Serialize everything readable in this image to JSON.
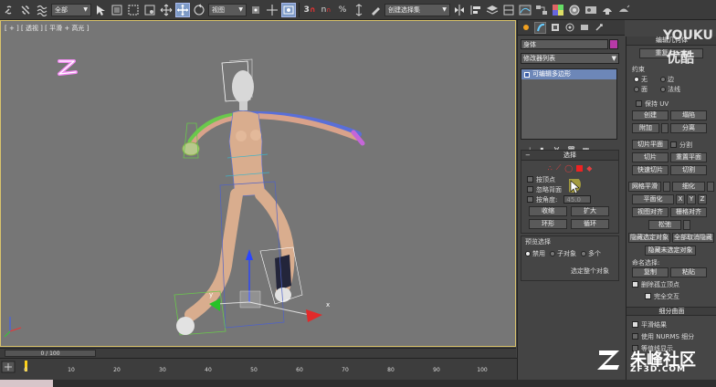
{
  "toolbar": {
    "selection_filter": "全部",
    "ref_coord": "视图",
    "named_selection": "创建选择集",
    "snap_label": "3",
    "angle_snap": "n",
    "percent_snap": "%"
  },
  "viewport": {
    "label": "[ + ] [ 透视 ] [ 平滑 + 高光 ]",
    "gizmo_labels": [
      "y",
      "x"
    ]
  },
  "command_panel": {
    "object_name": "身体",
    "modifier_list": "修改器列表",
    "stack_item": "可编辑多边形",
    "selection": {
      "header": "选择",
      "by_vertex": "按顶点",
      "ignore_backfacing": "忽略背面",
      "by_angle": "按角度:",
      "angle_value": "45.0",
      "shrink": "收缩",
      "grow": "扩大",
      "ring": "环形",
      "loop": "循环"
    },
    "preview": {
      "header": "预览选择",
      "off": "禁用",
      "subobject": "子对象",
      "multi": "多个",
      "whole_object": "选定整个对象"
    }
  },
  "right_panel": {
    "header": "编辑几何体",
    "repeat_last": "重复上一个",
    "constraints": "约束",
    "c_none": "无",
    "c_edge": "边",
    "c_face": "面",
    "c_normal": "法线",
    "preserve_uv": "保持 UV",
    "create": "创建",
    "collapse": "塌陷",
    "attach": "附加",
    "detach": "分离",
    "slice_plane": "切片平面",
    "split": "分割",
    "slice": "切片",
    "reset_plane": "重置平面",
    "quickslice": "快速切片",
    "cut": "切割",
    "meshsmooth": "网格平滑",
    "tessellate": "细化",
    "make_planar": "平面化",
    "x": "X",
    "y": "Y",
    "z": "Z",
    "view_align": "视图对齐",
    "grid_align": "栅格对齐",
    "relax": "松弛",
    "hide_selected": "隐藏选定对象",
    "unhide_all": "全部取消隐藏",
    "hide_unselected": "隐藏未选定对象",
    "named_sel": "命名选择:",
    "copy": "复制",
    "paste": "粘贴",
    "delete_iso": "删除孤立顶点",
    "full_interactivity": "完全交互",
    "subdiv_header": "细分曲面",
    "smooth_result": "平滑结果",
    "use_nurms": "使用 NURMS 细分",
    "isoline": "等值线显示"
  },
  "timeline": {
    "frame_display": "0 / 100",
    "ticks": [
      "0",
      "10",
      "20",
      "30",
      "40",
      "50",
      "60",
      "70",
      "80",
      "90",
      "100"
    ]
  },
  "watermark": {
    "youku_top": "YOUKU",
    "youku_bottom": "优酷",
    "zf_name": "朱峰社区",
    "zf_url": "ZF3D.COM"
  },
  "colors": {
    "viewport_bg": "#767676",
    "selection_highlight": "#6d87b8",
    "object_color": "#b83aa8",
    "active_frame_border": "#d9c36c"
  }
}
